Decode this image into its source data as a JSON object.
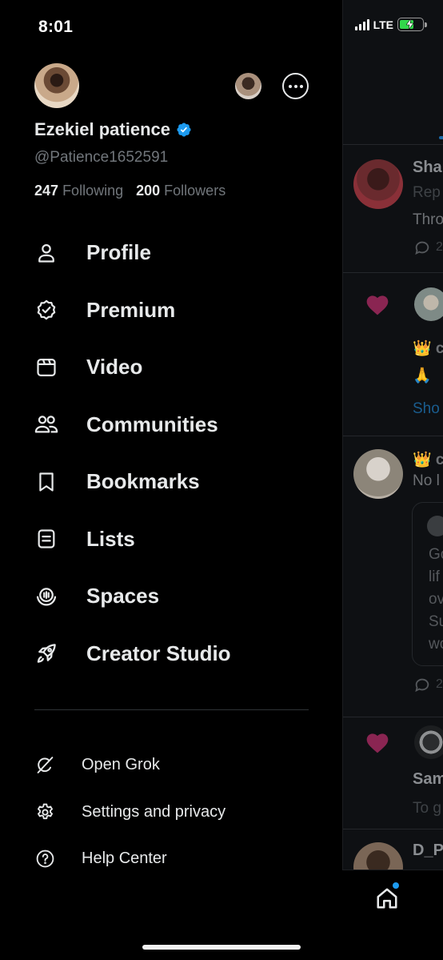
{
  "status_bar": {
    "time": "8:01",
    "network": "LTE"
  },
  "profile": {
    "name": "Ezekiel patience",
    "handle": "@Patience1652591",
    "following_count": "247",
    "following_label": "Following",
    "followers_count": "200",
    "followers_label": "Followers"
  },
  "menu": [
    {
      "label": "Profile",
      "icon": "person-icon"
    },
    {
      "label": "Premium",
      "icon": "verified-badge-icon"
    },
    {
      "label": "Video",
      "icon": "video-icon"
    },
    {
      "label": "Communities",
      "icon": "communities-icon"
    },
    {
      "label": "Bookmarks",
      "icon": "bookmark-icon"
    },
    {
      "label": "Lists",
      "icon": "list-icon"
    },
    {
      "label": "Spaces",
      "icon": "spaces-icon"
    },
    {
      "label": "Creator Studio",
      "icon": "rocket-icon"
    }
  ],
  "sub_menu": [
    {
      "label": "Open Grok",
      "icon": "grok-icon"
    },
    {
      "label": "Settings and privacy",
      "icon": "gear-icon"
    },
    {
      "label": "Help Center",
      "icon": "help-icon"
    }
  ],
  "feed": {
    "post1": {
      "name": "Sha",
      "line1": "Rep",
      "line2": "Thro",
      "replies": "2"
    },
    "post2": {
      "line1": "👑 c",
      "line2": "🙏",
      "link": "Sho"
    },
    "post3": {
      "line1": "👑 c",
      "line2": "No l",
      "quote": [
        "Go",
        "lif",
        "ov",
        "Su",
        "wo"
      ],
      "replies": "2"
    },
    "post4": {
      "name": "Sam",
      "line1": "To g"
    },
    "post5": {
      "name": "D_Pr"
    }
  },
  "colors": {
    "accent": "#1d9bf0",
    "heart": "#c0306e",
    "battery": "#32d74b"
  }
}
